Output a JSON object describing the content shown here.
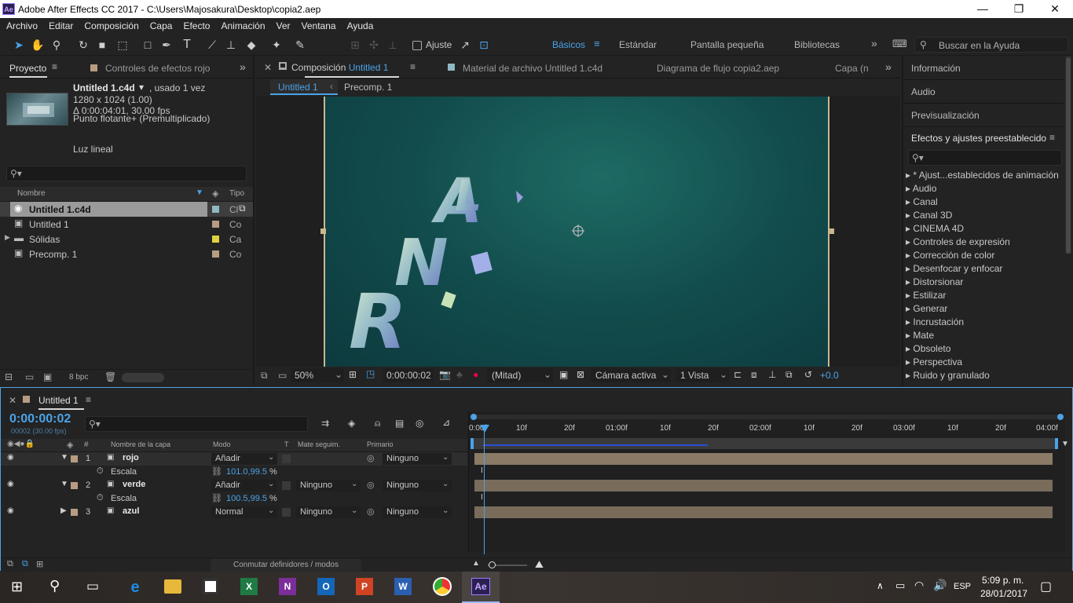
{
  "window": {
    "title": "Adobe After Effects CC 2017 - C:\\Users\\Majosakura\\Desktop\\copia2.aep",
    "logo": "Ae"
  },
  "menu": [
    "Archivo",
    "Editar",
    "Composición",
    "Capa",
    "Efecto",
    "Animación",
    "Ver",
    "Ventana",
    "Ayuda"
  ],
  "toolbar": {
    "snap_label": "Ajuste",
    "workspaces": [
      "Básicos",
      "Estándar",
      "Pantalla pequeña",
      "Bibliotecas"
    ],
    "active_workspace": "Básicos",
    "help_placeholder": "Buscar en la Ayuda",
    "more": "»"
  },
  "project": {
    "tab_project": "Proyecto",
    "tab_effects": "Controles de efectos rojo",
    "item_name": "Untitled 1.c4d",
    "item_used": ", usado 1 vez",
    "item_dims": "1280 x 1024 (1.00)",
    "item_duration": "Δ 0:00:04:01, 30.00 fps",
    "item_color": "Punto flotante+ (Premultiplicado)",
    "item_light": "Luz lineal",
    "col_name": "Nombre",
    "col_type": "Tipo",
    "items": [
      {
        "name": "Untitled 1.c4d",
        "type": "Cl",
        "color": "#8fb8c0"
      },
      {
        "name": "Untitled 1",
        "type": "Co",
        "color": "#b89c82"
      },
      {
        "name": "Sólidas",
        "type": "Ca",
        "color": "#e0d040"
      },
      {
        "name": "Precomp. 1",
        "type": "Co",
        "color": "#b89c82"
      }
    ],
    "bpc": "8 bpc"
  },
  "viewer": {
    "tab_comp_prefix": "Composición",
    "tab_comp_name": "Untitled 1",
    "tab_footage": "Material de archivo  Untitled 1.c4d",
    "tab_flow": "Diagrama de flujo  copia2.aep",
    "tab_layer": "Capa  (n",
    "breadcrumb_1": "Untitled 1",
    "breadcrumb_2": "Precomp. 1",
    "zoom": "50%",
    "timecode": "0:00:00:02",
    "resolution": "(Mitad)",
    "camera": "Cámara activa",
    "views": "1 Vista",
    "exposure": "+0.0"
  },
  "right": {
    "info": "Información",
    "audio": "Audio",
    "preview": "Previsualización",
    "effects_title": "Efectos y ajustes preestablecidos",
    "effects": [
      "* Ajust...establecidos de animación",
      "Audio",
      "Canal",
      "Canal 3D",
      "CINEMA 4D",
      "Controles de expresión",
      "Corrección de color",
      "Desenfocar y enfocar",
      "Distorsionar",
      "Estilizar",
      "Generar",
      "Incrustación",
      "Mate",
      "Obsoleto",
      "Perspectiva",
      "Ruido y granulado"
    ]
  },
  "timeline": {
    "tab": "Untitled 1",
    "timecode": "0:00:00:02",
    "frames": "00002 (30.00 fps)",
    "col_hash": "#",
    "col_layer": "Nombre de la capa",
    "col_mode": "Modo",
    "col_t": "T",
    "col_track": "Mate seguim.",
    "col_parent": "Primario",
    "ruler": [
      "0:00f",
      "10f",
      "20f",
      "01:00f",
      "10f",
      "20f",
      "02:00f",
      "10f",
      "20f",
      "03:00f",
      "10f",
      "20f",
      "04:00f"
    ],
    "layers": [
      {
        "num": "1",
        "name": "rojo",
        "mode": "Añadir",
        "track": "",
        "parent": "Ninguno",
        "prop": "Escala",
        "value": "101.0,99.5",
        "unit": "%"
      },
      {
        "num": "2",
        "name": "verde",
        "mode": "Añadir",
        "track": "Ninguno",
        "parent": "Ninguno",
        "prop": "Escala",
        "value": "100.5,99.5",
        "unit": "%"
      },
      {
        "num": "3",
        "name": "azul",
        "mode": "Normal",
        "track": "Ninguno",
        "parent": "Ninguno"
      }
    ],
    "toggle_label": "Conmutar definidores / modos"
  },
  "taskbar": {
    "lang": "ESP",
    "time": "5:09 p. m.",
    "date": "28/01/2017"
  }
}
